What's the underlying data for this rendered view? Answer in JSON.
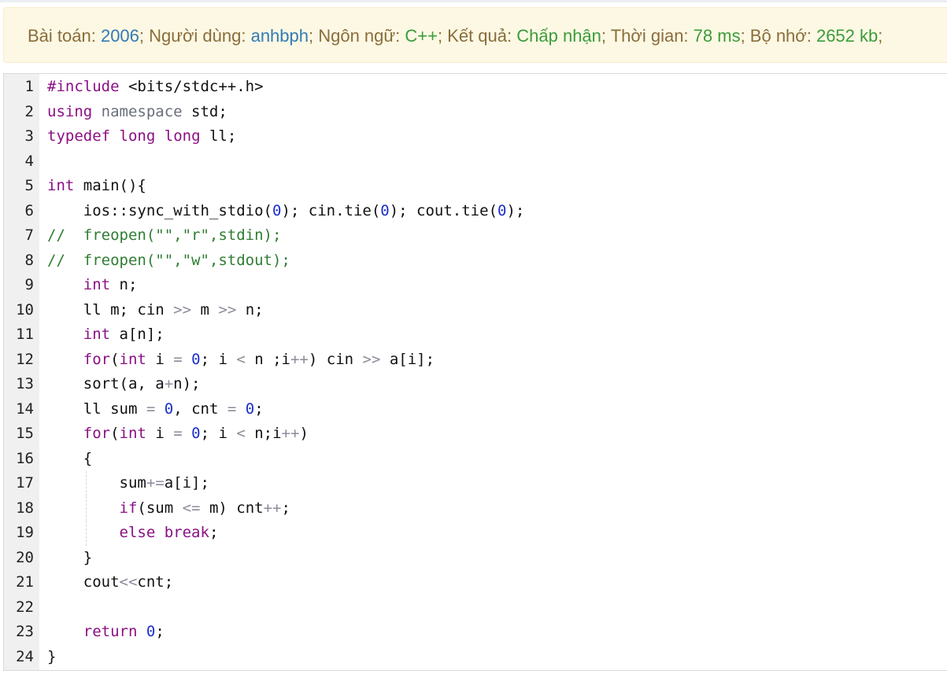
{
  "info": {
    "problem_label": "Bài toán: ",
    "problem_id": "2006",
    "user_label": "; Người dùng: ",
    "user": "anhbph",
    "lang_label": "; Ngôn ngữ: ",
    "lang": "C++",
    "result_label": "; Kết quả: ",
    "result": "Chấp nhận",
    "time_label": "; Thời gian: ",
    "time": "78 ms",
    "mem_label": "; Bộ nhớ: ",
    "mem": "2652 kb",
    "end": ";"
  },
  "colors": {
    "info_bg": "#fcf8e3",
    "info_text": "#8a6d3b",
    "link": "#337ab7",
    "success": "#3c9c3c",
    "keyword": "#8a0f84",
    "number": "#1a2fc9",
    "comment": "#2e7d32"
  },
  "code": [
    "#include <bits/stdc++.h>",
    "using namespace std;",
    "typedef long long ll;",
    "",
    "int main(){",
    "    ios::sync_with_stdio(0); cin.tie(0); cout.tie(0);",
    "//  freopen(\"\",\"r\",stdin);",
    "//  freopen(\"\",\"w\",stdout);",
    "    int n;",
    "    ll m; cin >> m >> n;",
    "    int a[n];",
    "    for(int i = 0; i < n ;i++) cin >> a[i];",
    "    sort(a, a+n);",
    "    ll sum = 0, cnt = 0;",
    "    for(int i = 0; i < n;i++)",
    "    {",
    "        sum+=a[i];",
    "        if(sum <= m) cnt++;",
    "        else break;",
    "    }",
    "    cout<<cnt;",
    "",
    "    return 0;",
    "}"
  ]
}
